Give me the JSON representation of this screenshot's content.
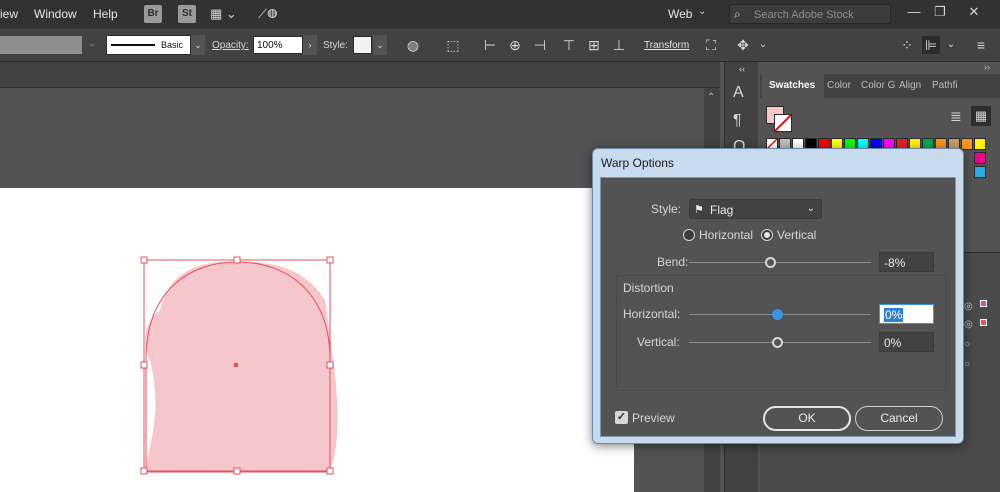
{
  "menubar": {
    "menus": [
      "iew",
      "Window",
      "Help"
    ],
    "app_icons": [
      {
        "name": "bridge-icon",
        "label": "Br"
      },
      {
        "name": "stock-icon",
        "label": "St"
      }
    ],
    "workspace_label": "Web",
    "search_placeholder": "Search Adobe Stock"
  },
  "control_bar": {
    "stroke_style": "Basic",
    "opacity_label": "Opacity:",
    "opacity_value": "100%",
    "style_label": "Style:",
    "transform_label": "Transform"
  },
  "swatches_panel": {
    "tabs": [
      "Swatches",
      "Color",
      "Color G",
      "Align",
      "Pathfi"
    ],
    "swatch_colors": [
      "#ffffff",
      "#000000",
      "#ff0000",
      "#ffff00",
      "#00ff00",
      "#00ffff",
      "#0000ff",
      "#ff00ff",
      "#ed1c24",
      "#fff200",
      "#00a651",
      "#f7941d",
      "#c69c6d"
    ],
    "fill_color": "#f5c6cb"
  },
  "dialog": {
    "title": "Warp Options",
    "style_label": "Style:",
    "style_value": "Flag",
    "orientation": {
      "horizontal_label": "Horizontal",
      "vertical_label": "Vertical",
      "selected": "Vertical"
    },
    "bend_label": "Bend:",
    "bend_value": "-8%",
    "distortion_label": "Distortion",
    "dist_horizontal_label": "Horizontal:",
    "dist_horizontal_value": "0%",
    "dist_vertical_label": "Vertical:",
    "dist_vertical_value": "0%",
    "preview_label": "Preview",
    "preview_checked": true,
    "ok_label": "OK",
    "cancel_label": "Cancel"
  },
  "artwork": {
    "shape_fill": "#f5c6cb",
    "selection_color": "#e8515b"
  }
}
